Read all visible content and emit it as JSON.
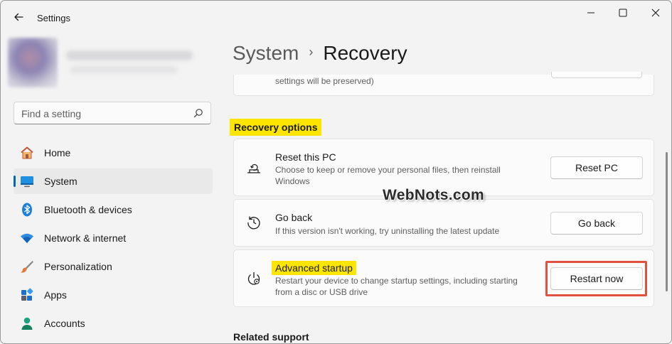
{
  "window": {
    "title": "Settings"
  },
  "sidebar": {
    "search_placeholder": "Find a setting",
    "items": [
      {
        "label": "Home",
        "icon": "home-icon",
        "active": false
      },
      {
        "label": "System",
        "icon": "system-icon",
        "active": true
      },
      {
        "label": "Bluetooth & devices",
        "icon": "bluetooth-icon",
        "active": false
      },
      {
        "label": "Network & internet",
        "icon": "wifi-icon",
        "active": false
      },
      {
        "label": "Personalization",
        "icon": "brush-icon",
        "active": false
      },
      {
        "label": "Apps",
        "icon": "apps-icon",
        "active": false
      },
      {
        "label": "Accounts",
        "icon": "account-icon",
        "active": false
      }
    ]
  },
  "main": {
    "breadcrumb": {
      "parent": "System",
      "separator": "›",
      "current": "Recovery"
    },
    "partial_card_text": "settings will be preserved)",
    "section_title": "Recovery options",
    "cards": [
      {
        "title": "Reset this PC",
        "description": "Choose to keep or remove your personal files, then reinstall Windows",
        "button": "Reset PC",
        "icon": "reset-pc-icon"
      },
      {
        "title": "Go back",
        "description": "If this version isn't working, try uninstalling the latest update",
        "button": "Go back",
        "icon": "history-icon"
      },
      {
        "title": "Advanced startup",
        "description": "Restart your device to change startup settings, including starting from a disc or USB drive",
        "button": "Restart now",
        "icon": "advanced-startup-icon"
      }
    ],
    "related_title": "Related support"
  },
  "watermark": "WebNots.com",
  "colors": {
    "accent": "#0067c0",
    "highlight": "#fde500",
    "callout_border": "#e0523f"
  }
}
